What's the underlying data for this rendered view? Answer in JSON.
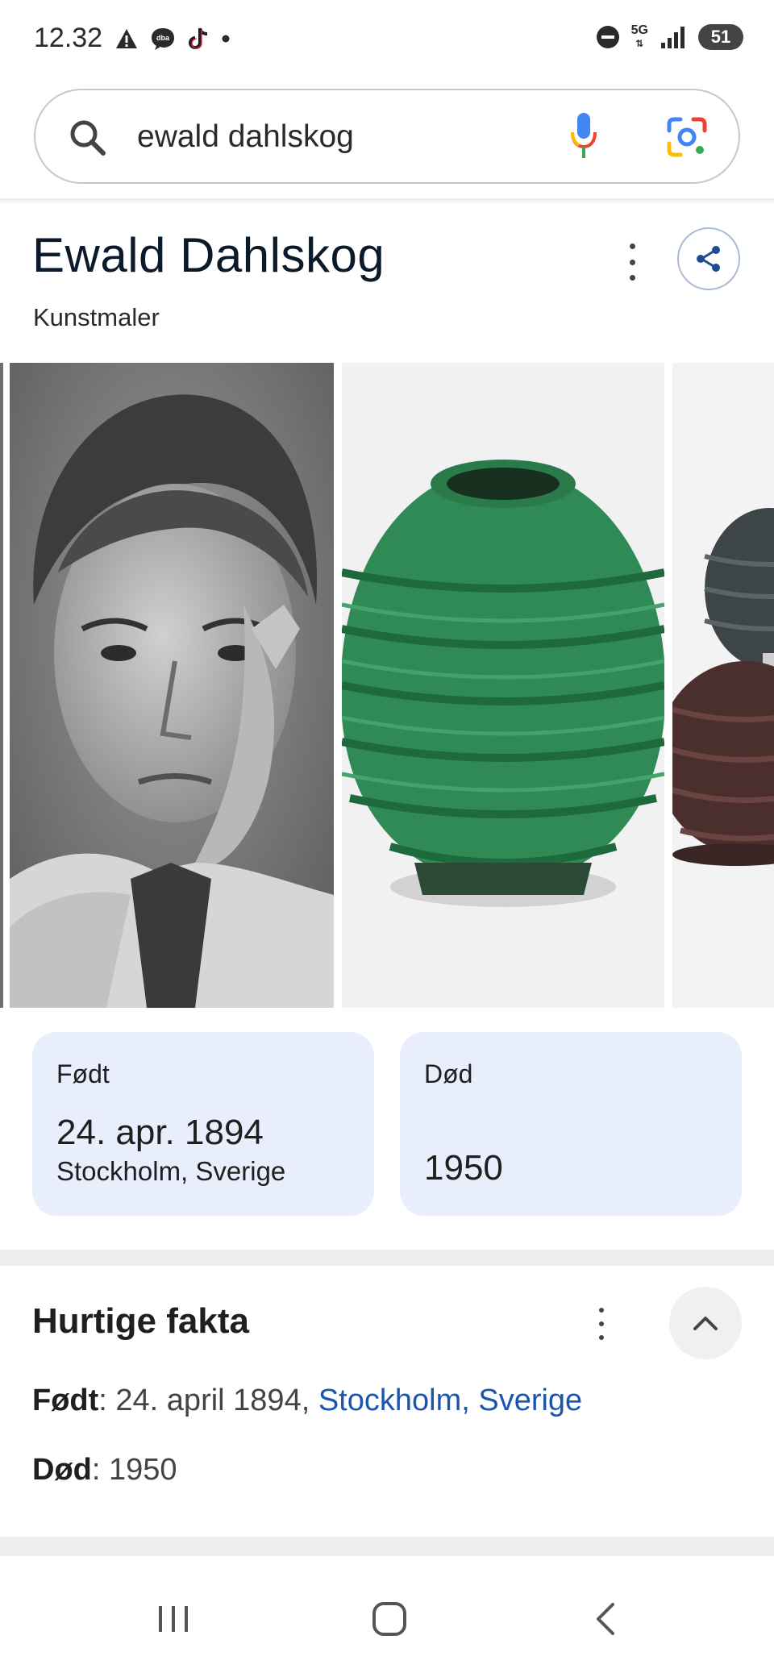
{
  "status_bar": {
    "time": "12.32",
    "left_icons": [
      "warning-icon",
      "dba-icon",
      "tiktok-icon",
      "dot-icon"
    ],
    "right_icons": [
      "dnd-icon",
      "network-5g-icon",
      "signal-icon"
    ],
    "network": "5G",
    "battery": "51"
  },
  "search": {
    "query": "ewald dahlskog",
    "icons": [
      "search-icon",
      "mic-icon",
      "lens-icon"
    ]
  },
  "entity": {
    "title": "Ewald Dahlskog",
    "subtitle": "Kunstmaler"
  },
  "images": [
    {
      "name": "portrait-image"
    },
    {
      "name": "green-vase-image"
    },
    {
      "name": "dark-vases-image"
    }
  ],
  "cards": {
    "born": {
      "label": "Født",
      "date": "24. apr. 1894",
      "place": "Stockholm, Sverige"
    },
    "died": {
      "label": "Død",
      "date": "1950"
    }
  },
  "quick_facts": {
    "title": "Hurtige fakta",
    "born_key": "Født",
    "born_date": " 24. april 1894, ",
    "born_place": "Stockholm, Sverige",
    "died_key": "Død",
    "died_date": " 1950"
  },
  "colors": {
    "card_bg": "#e8eefc",
    "link": "#1a55b0",
    "title": "#0b1a2a"
  }
}
